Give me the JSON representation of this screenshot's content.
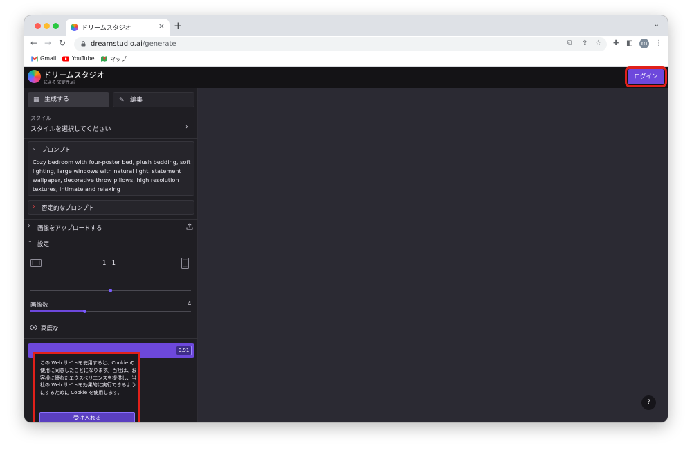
{
  "browser": {
    "tab_title": "ドリームスタジオ",
    "tab_close": "×",
    "new_tab": "+",
    "tab_menu": "⌄",
    "url_domain": "dreamstudio.ai",
    "url_path": "/generate",
    "nav_back": "←",
    "nav_forward": "→",
    "nav_reload": "↻",
    "profile_initial": "m",
    "bookmarks": [
      {
        "label": "Gmail"
      },
      {
        "label": "YouTube"
      },
      {
        "label": "マップ"
      }
    ]
  },
  "app": {
    "brand_name": "ドリームスタジオ",
    "brand_sub": "による 安定性.ai",
    "login_label": "ログイン",
    "accent_color": "#6d48dc"
  },
  "sidebar": {
    "tab_generate": "生成する",
    "tab_edit": "編集",
    "style_label": "スタイル",
    "style_value": "スタイルを選択してください",
    "prompt_title": "プロンプト",
    "prompt_text": "Cozy bedroom with four-poster bed, plush bedding, soft lighting, large windows with natural light, statement wallpaper, decorative throw pillows, high resolution textures, intimate and relaxing",
    "negative_prompt_title": "否定的なプロンプト",
    "upload_label": "画像をアップロードする",
    "settings_label": "設定",
    "aspect_ratio": "1 : 1",
    "aspect_ratio_position": 0.5,
    "image_count_label": "画像数",
    "image_count_value": "4",
    "image_count_position": 0.34,
    "advanced_label": "高度な",
    "generate_badge": "0.91"
  },
  "cookie_banner": {
    "text": "この Web サイトを使用すると、Cookie の使用に同意したことになります。当社は、お客様に優れたエクスペリエンスを提供し、当社の Web サイトを効果的に実行できるようにするために Cookie を使用します。",
    "accept_label": "受け入れる"
  },
  "help": {
    "label": "?"
  }
}
